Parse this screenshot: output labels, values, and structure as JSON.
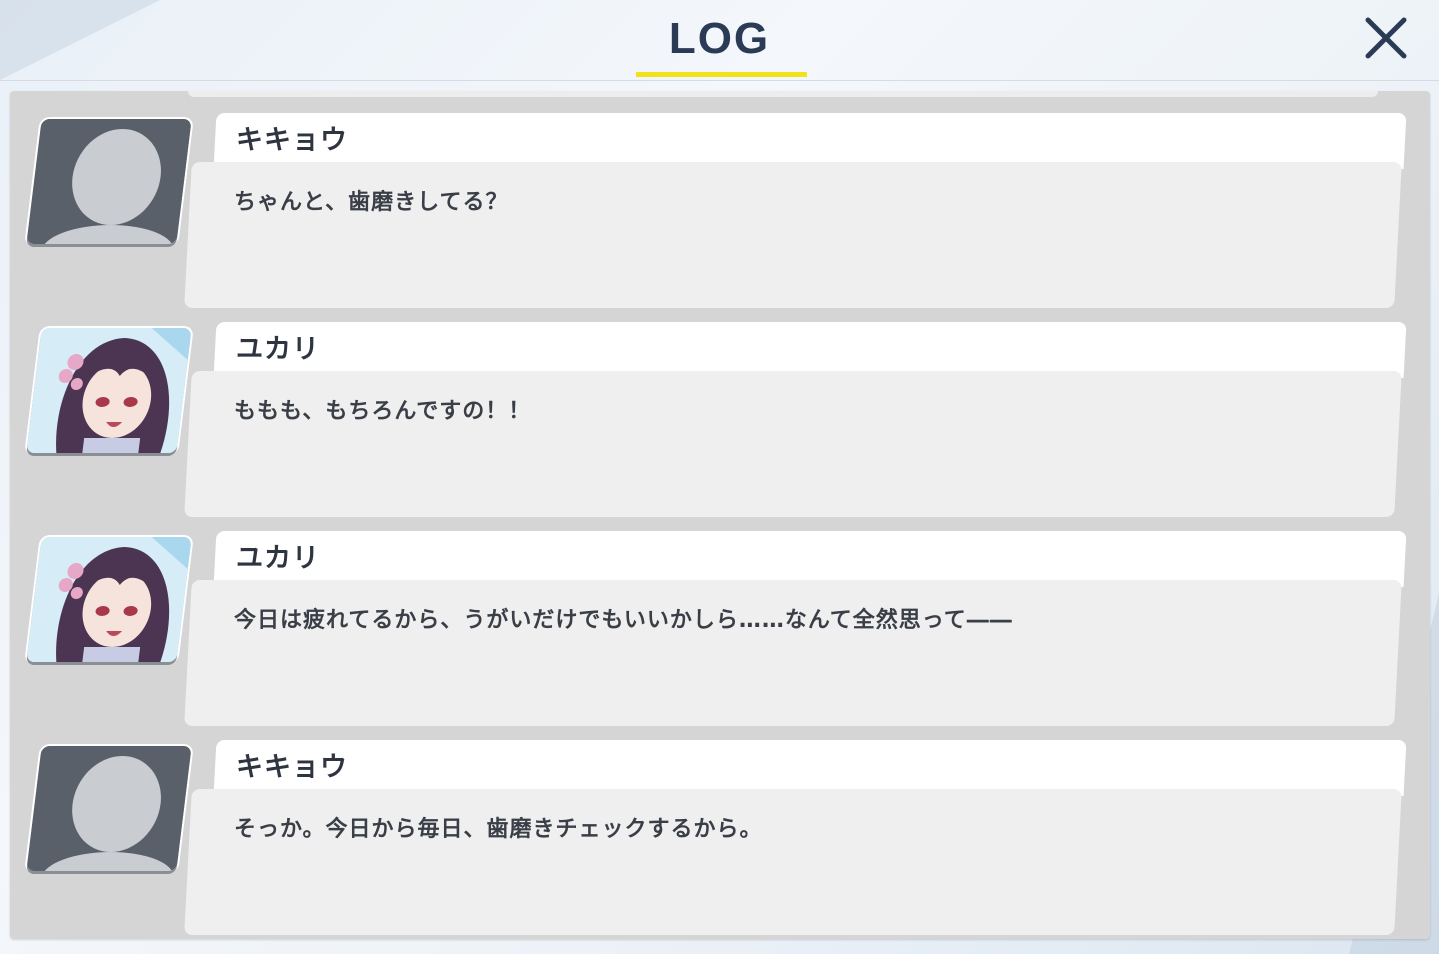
{
  "header": {
    "title": "LOG",
    "close_icon": "close-icon"
  },
  "colors": {
    "title": "#2b3b55",
    "underline": "#f2e21c",
    "panel": "#d5d5d5",
    "name_bar": "#ffffff",
    "message_box": "#efefef"
  },
  "log": [
    {
      "speaker": "キキョウ",
      "avatar": "silhouette-avatar",
      "text": "ちゃんと、歯磨きしてる？"
    },
    {
      "speaker": "ユカリ",
      "avatar": "character-portrait",
      "text": "ももも、もちろんですの！！"
    },
    {
      "speaker": "ユカリ",
      "avatar": "character-portrait",
      "text": "今日は疲れてるから、うがいだけでもいいかしら……なんて全然思って――"
    },
    {
      "speaker": "キキョウ",
      "avatar": "silhouette-avatar",
      "text": "そっか。今日から毎日、歯磨きチェックするから。"
    }
  ]
}
